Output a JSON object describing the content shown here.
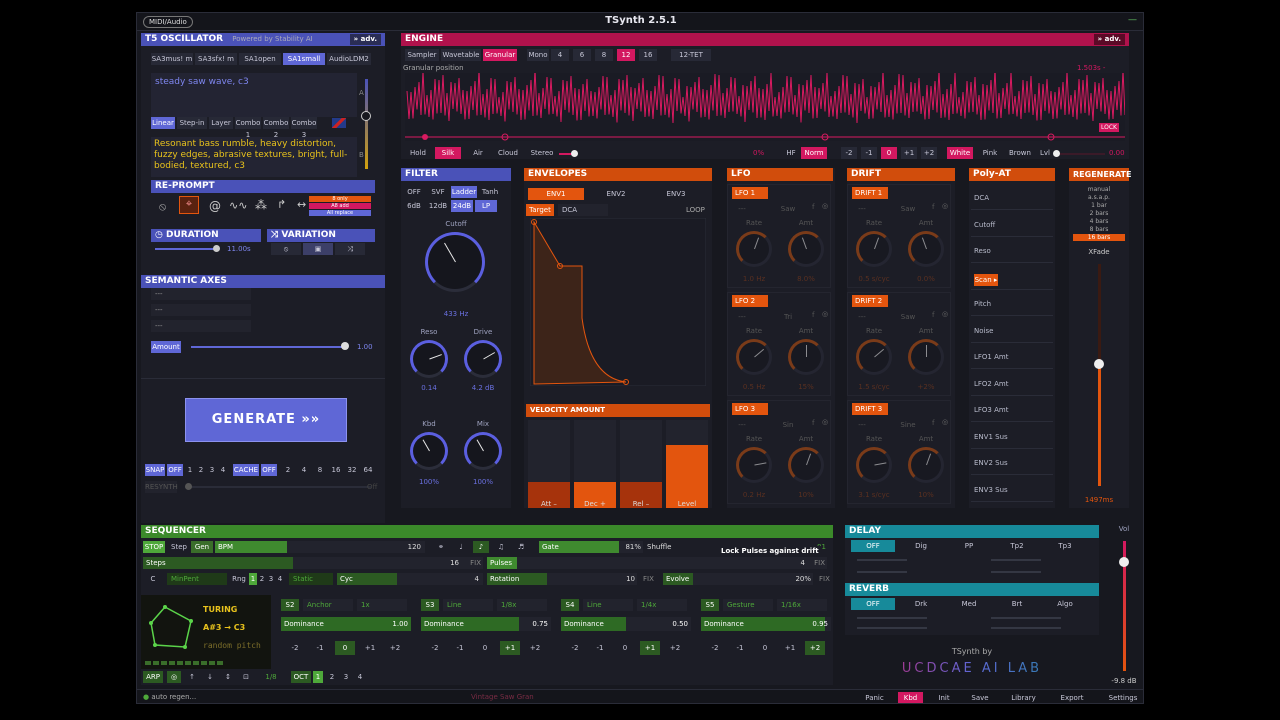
{
  "app": {
    "title": "TSynth 2.5.1",
    "midi_label": "MIDI/Audio",
    "window_control": "—"
  },
  "osc": {
    "title": "T5 OSCILLATOR",
    "powered": "Powered by Stability AI",
    "adv": "» adv.",
    "models": [
      "SA3mus! m",
      "SA3sfx! m",
      "SA1open",
      "SA1small",
      "AudioLDM2"
    ],
    "selected_model": "SA1small",
    "prompt": "steady saw wave, c3",
    "slider_a": "A",
    "slider_b": "B",
    "modes": [
      "Linear",
      "Step-in",
      "Layer",
      "Combo 1",
      "Combo 2",
      "Combo 3"
    ],
    "flag_icon": "uk-flag-icon",
    "description": "Resonant bass rumble, heavy distortion, fuzzy edges, abrasive textures, bright, full-bodied, textured, c3"
  },
  "reprompt": {
    "title": "RE-PROMPT",
    "options": [
      "8 only",
      "A8 add",
      "All replace"
    ]
  },
  "duration": {
    "title": "DURATION",
    "value": "11.00s"
  },
  "variation": {
    "title": "VARIATION"
  },
  "semantic": {
    "title": "SEMANTIC AXES",
    "axes": [
      "---",
      "---",
      "---"
    ],
    "amount_label": "Amount",
    "amount_value": "1.00",
    "amount_fraction": 1.0
  },
  "generate": {
    "label": "GENERATE »»"
  },
  "snap": {
    "label": "SNAP",
    "off": "OFF",
    "nums": [
      "1",
      "2",
      "3",
      "4"
    ],
    "cache_label": "CACHE",
    "cache_off": "OFF",
    "cache_nums": [
      "2",
      "4",
      "8",
      "16",
      "32",
      "64"
    ],
    "resynth": "RESYNTH",
    "resynth_state": "Off"
  },
  "engine": {
    "title": "ENGINE",
    "adv": "» adv.",
    "modes": [
      "Sampler",
      "Wavetable",
      "Granular"
    ],
    "selected_mode": "Granular",
    "voice_label": "Mono",
    "voices": [
      "4",
      "6",
      "8",
      "12",
      "16"
    ],
    "selected_voice": "12",
    "tuning": "12-TET",
    "granular_label": "Granular position",
    "range": "1.503s - 9.851s",
    "lock": "LOCK",
    "buttons": [
      "Hold",
      "Silk",
      "Air",
      "Cloud"
    ],
    "stereo": "Stereo",
    "pct": "0%",
    "hf": "HF",
    "norm": "Norm",
    "octs": [
      "-2",
      "-1",
      "0",
      "+1",
      "+2"
    ],
    "noise": [
      "White",
      "Pink",
      "Brown"
    ],
    "lvl": "Lvl",
    "db": "0.00"
  },
  "filter": {
    "title": "FILTER",
    "types": [
      "OFF",
      "SVF",
      "Ladder",
      "Tanh"
    ],
    "slopes": [
      "6dB",
      "12dB",
      "24dB",
      "LP"
    ],
    "cutoff_label": "Cutoff",
    "cutoff_value": "433 Hz",
    "reso_label": "Reso",
    "reso_value": "0.14",
    "drive_label": "Drive",
    "drive_value": "4.2 dB",
    "kbd_label": "Kbd",
    "kbd_value": "100%",
    "mix_label": "Mix",
    "mix_value": "100%"
  },
  "env": {
    "title": "ENVELOPES",
    "tabs": [
      "ENV1",
      "ENV2",
      "ENV3"
    ],
    "target_label": "Target",
    "target": "DCA",
    "loop": "LOOP",
    "velocity_title": "VELOCITY AMOUNT",
    "vel_labels": [
      "Att –",
      "Dec +",
      "Rel –",
      "Level"
    ],
    "vel_values": [
      0.3,
      0.3,
      0.3,
      0.72
    ]
  },
  "lfo": {
    "title": "LFO",
    "units": [
      {
        "name": "LFO 1",
        "shape": "Saw",
        "rate": "1.0 Hz",
        "amt": "8.0%"
      },
      {
        "name": "LFO 2",
        "shape": "Tri",
        "rate": "0.5 Hz",
        "amt": "15%"
      },
      {
        "name": "LFO 3",
        "shape": "Sin",
        "rate": "0.2 Hz",
        "amt": "10%"
      }
    ],
    "rate_label": "Rate",
    "amt_label": "Amt"
  },
  "drift": {
    "title": "DRIFT",
    "units": [
      {
        "name": "DRIFT 1",
        "shape": "Saw",
        "rate": "0.5 s/cyc",
        "amt": "0.0%"
      },
      {
        "name": "DRIFT 2",
        "shape": "Saw",
        "rate": "1.5 s/cyc",
        "amt": "+2%"
      },
      {
        "name": "DRIFT 3",
        "shape": "Sine",
        "rate": "3.1 s/cyc",
        "amt": "10%"
      }
    ],
    "rate_label": "Rate",
    "amt_label": "Amt"
  },
  "polyat": {
    "title": "Poly-AT",
    "items": [
      "DCA",
      "Cutoff",
      "Reso",
      "Scan",
      "Pitch",
      "Noise",
      "LFO1 Amt",
      "LFO2 Amt",
      "LFO3 Amt",
      "ENV1 Sus",
      "ENV2 Sus",
      "ENV3 Sus"
    ],
    "selected": "Scan"
  },
  "regen": {
    "title": "REGENERATE",
    "options": [
      "manual",
      "a.s.a.p.",
      "1 bar",
      "2 bars",
      "4 bars",
      "8 bars",
      "16 bars"
    ],
    "selected": "16 bars",
    "xfade": "XFade",
    "ms": "1497ms",
    "xfade_fraction": 0.55
  },
  "seq": {
    "title": "SEQUENCER",
    "stop": "STOP",
    "step": "Step",
    "gen": "Gen",
    "bpm_label": "BPM",
    "bpm": "120",
    "gate": "Gate",
    "gate_pct": "81%",
    "shuffle": "Shuffle",
    "shuffle_val": "81",
    "tooltip": "Lock Pulses against drift",
    "steps": "Steps",
    "steps_val": "16",
    "fix": "FIX",
    "pulses": "Pulses",
    "pulses_val": "4",
    "c": "C",
    "minpent": "MinPent",
    "rng": "Rng",
    "rng_nums": [
      "1",
      "2",
      "3",
      "4"
    ],
    "static": "Static",
    "cyc": "Cyc",
    "cyc_val": "4",
    "rotation": "Rotation",
    "rotation_val": "10",
    "evolve": "Evolve",
    "evolve_val": "20%",
    "turing": "TURING",
    "turing_range": "A#3 → C3",
    "turing_desc": "random pitch",
    "slots": [
      {
        "id": "S2",
        "type": "Anchor",
        "div": "1x",
        "dom": "1.00",
        "sel": "0"
      },
      {
        "id": "S3",
        "type": "Line",
        "div": "1/8x",
        "dom": "0.75",
        "sel": "+1"
      },
      {
        "id": "S4",
        "type": "Line",
        "div": "1/4x",
        "dom": "0.50",
        "sel": "+1"
      },
      {
        "id": "S5",
        "type": "Gesture",
        "div": "1/16x",
        "dom": "0.95",
        "sel": "+2"
      }
    ],
    "dominance": "Dominance",
    "octs": [
      "-2",
      "-1",
      "0",
      "+1",
      "+2"
    ],
    "arp": "ARP",
    "arp_div": "1/8",
    "oct": "OCT",
    "oct_nums": [
      "1",
      "2",
      "3",
      "4"
    ]
  },
  "delay": {
    "title": "DELAY",
    "tabs": [
      "OFF",
      "Dig",
      "PP",
      "Tp2",
      "Tp3"
    ]
  },
  "reverb": {
    "title": "REVERB",
    "tabs": [
      "OFF",
      "Drk",
      "Med",
      "Brt",
      "Algo"
    ]
  },
  "vol": {
    "label": "Vol",
    "db": "-9.8 dB"
  },
  "credits": {
    "by": "TSynth by",
    "lab": "UCDCAE AI LAB"
  },
  "footer": {
    "status": "auto regen...",
    "preset": "Vintage Saw Gran",
    "buttons": [
      "Panic",
      "Kbd",
      "Init",
      "Save",
      "Library",
      "Export",
      "Settings",
      "Manual"
    ],
    "active": "Kbd"
  }
}
